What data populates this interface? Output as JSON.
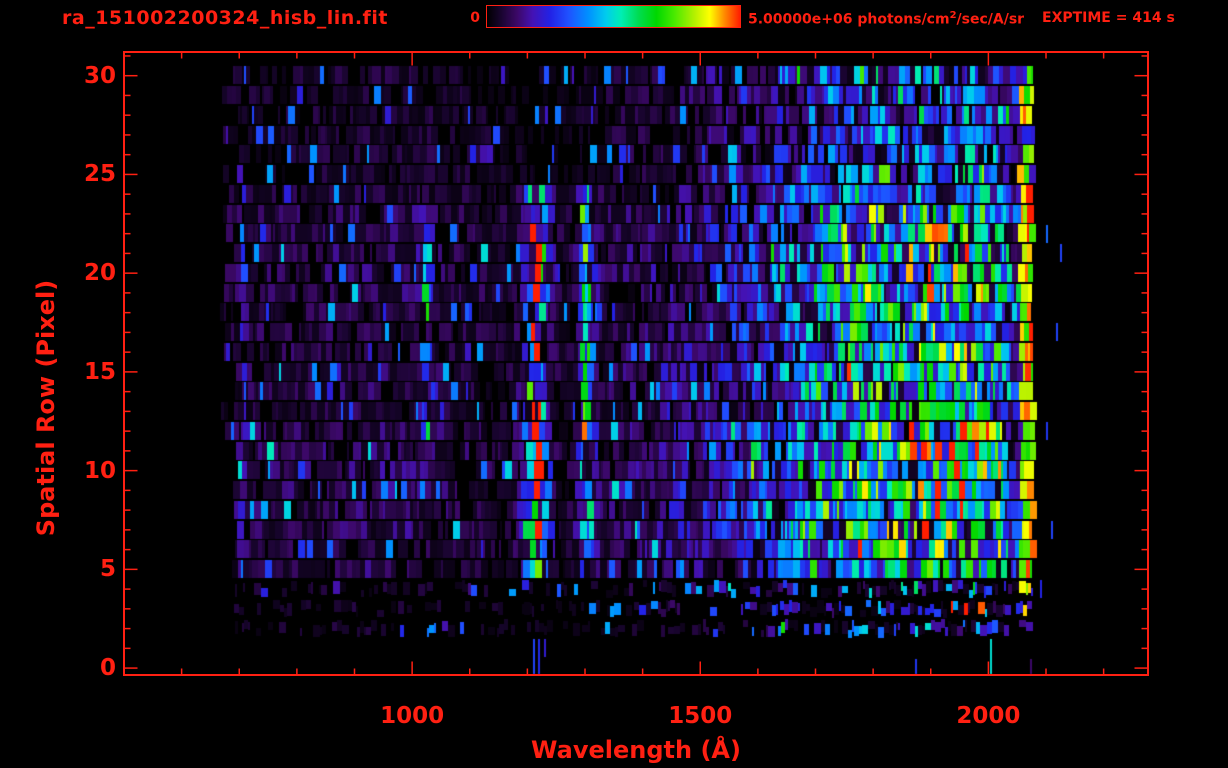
{
  "colors": {
    "accent": "#ff2012",
    "background": "#000000"
  },
  "header": {
    "title": "ra_151002200324_hisb_lin.fit",
    "exptime": "EXPTIME = 414 s",
    "colorbar": {
      "min_label": "0",
      "max_label_prefix": "5.00000e+06 photons/cm",
      "max_label_sup": "2",
      "max_label_suffix": "/sec/A/sr"
    }
  },
  "chart_data": {
    "type": "heatmap",
    "title": "ra_151002200324_hisb_lin.fit",
    "xlabel": "Wavelength (Å)",
    "ylabel": "Spatial Row (Pixel)",
    "xlim": [
      500,
      2277
    ],
    "ylim": [
      -0.35,
      31.2
    ],
    "x_major_ticks": [
      1000,
      1500,
      2000
    ],
    "x_minor_step": 100,
    "x_minor_range": [
      500,
      2200
    ],
    "y_major_ticks": [
      0,
      5,
      10,
      15,
      20,
      25,
      30
    ],
    "y_minor_step": 1,
    "y_minor_range": [
      0,
      31
    ],
    "colorbar": {
      "min": 0,
      "max": 5000000,
      "units": "photons/cm^2/sec/A/sr"
    },
    "exposure_time_s": 414,
    "colormap_stops": [
      [
        0,
        "#000000"
      ],
      [
        0.05,
        "#16042a"
      ],
      [
        0.12,
        "#3c0868"
      ],
      [
        0.18,
        "#4412b4"
      ],
      [
        0.25,
        "#2222e6"
      ],
      [
        0.32,
        "#2050ff"
      ],
      [
        0.4,
        "#0090ff"
      ],
      [
        0.47,
        "#00ccee"
      ],
      [
        0.53,
        "#00eeb4"
      ],
      [
        0.6,
        "#00dc50"
      ],
      [
        0.67,
        "#00d800"
      ],
      [
        0.74,
        "#48ea00"
      ],
      [
        0.82,
        "#b4f000"
      ],
      [
        0.88,
        "#ffff00"
      ],
      [
        0.94,
        "#ff8800"
      ],
      [
        1,
        "#ff1e00"
      ]
    ],
    "data_extent": {
      "wavelength": [
        665,
        2074
      ],
      "rows": [
        2,
        30
      ]
    },
    "row_profile": [
      0,
      0,
      0.06,
      0.1,
      0.12,
      0.45,
      0.75,
      0.9,
      0.95,
      1,
      1,
      0.9,
      0.8,
      0.5,
      0.65,
      0.7,
      0.7,
      0.65,
      0.6,
      0.8,
      0.85,
      0.85,
      0.8,
      0.75,
      0.35,
      0.22,
      0.2,
      0.18,
      0.2,
      0.18,
      0.22
    ],
    "continuum": [
      [
        660,
        0.085
      ],
      [
        800,
        0.09
      ],
      [
        900,
        0.1
      ],
      [
        1000,
        0.1
      ],
      [
        1060,
        0.085
      ],
      [
        1120,
        0.08
      ],
      [
        1170,
        0.06
      ],
      [
        1195,
        0.07
      ],
      [
        1245,
        0.05
      ],
      [
        1285,
        0.06
      ],
      [
        1330,
        0.1
      ],
      [
        1430,
        0.12
      ],
      [
        1520,
        0.18
      ],
      [
        1600,
        0.28
      ],
      [
        1680,
        0.42
      ],
      [
        1760,
        0.54
      ],
      [
        1850,
        0.6
      ],
      [
        1950,
        0.62
      ],
      [
        2020,
        0.58
      ],
      [
        2040,
        0.3
      ],
      [
        2054,
        0.25
      ]
    ],
    "spectral_lines": [
      {
        "center": 1216,
        "sigma": 6,
        "halo": 0.35,
        "halo_sigma": 16,
        "amp_base": 0.55,
        "amp_row": 0.6,
        "rows": [
          5,
          24
        ]
      },
      {
        "center": 1302,
        "sigma": 5,
        "halo": 0.3,
        "halo_sigma": 11,
        "amp_base": 0.22,
        "amp_row": 0.35,
        "rows": [
          5,
          24
        ]
      },
      {
        "center": 1025,
        "sigma": 4.5,
        "halo": 0.3,
        "halo_sigma": 9,
        "amp_base": 0.06,
        "amp_row": 0.25,
        "rows": [
          12,
          23
        ]
      },
      {
        "center": 706,
        "sigma": 3.5,
        "halo": 0,
        "halo_sigma": 1,
        "amp_base": 0.16,
        "amp_row": 0.05,
        "rows": [
          5,
          24
        ]
      }
    ],
    "saturated_edge": {
      "wavelength": [
        2056,
        2074
      ],
      "rows": [
        3,
        30
      ],
      "value_base": 0.86,
      "value_jitter": 0.18
    },
    "bright_patch": {
      "rows": [
        3,
        4
      ],
      "wavelength": [
        1925,
        2052
      ],
      "bonus": 0.3
    },
    "isolated_marks": [
      {
        "wavelength": 1209,
        "row_from": 0,
        "row_to": 1,
        "value": 0.3
      },
      {
        "wavelength": 1219,
        "row_from": 0,
        "row_to": 1,
        "value": 0.26
      },
      {
        "wavelength": 1228,
        "row_from": 1,
        "row_to": 1,
        "value": 0.22
      },
      {
        "wavelength": 1872,
        "row_from": 0,
        "row_to": 0,
        "value": 0.28
      },
      {
        "wavelength": 2002,
        "row_from": 0,
        "row_to": 1,
        "value": 0.5
      },
      {
        "wavelength": 2072,
        "row_from": 0,
        "row_to": 0,
        "value": 0.12
      },
      {
        "wavelength": 2100,
        "row_from": 22,
        "row_to": 22,
        "value": 0.35
      },
      {
        "wavelength": 2125,
        "row_from": 21,
        "row_to": 21,
        "value": 0.3
      },
      {
        "wavelength": 2118,
        "row_from": 17,
        "row_to": 17,
        "value": 0.3
      },
      {
        "wavelength": 2100,
        "row_from": 12,
        "row_to": 12,
        "value": 0.28
      },
      {
        "wavelength": 2108,
        "row_from": 7,
        "row_to": 7,
        "value": 0.3
      },
      {
        "wavelength": 2090,
        "row_from": 4,
        "row_to": 4,
        "value": 0.25
      }
    ],
    "render_seed": 12345
  }
}
